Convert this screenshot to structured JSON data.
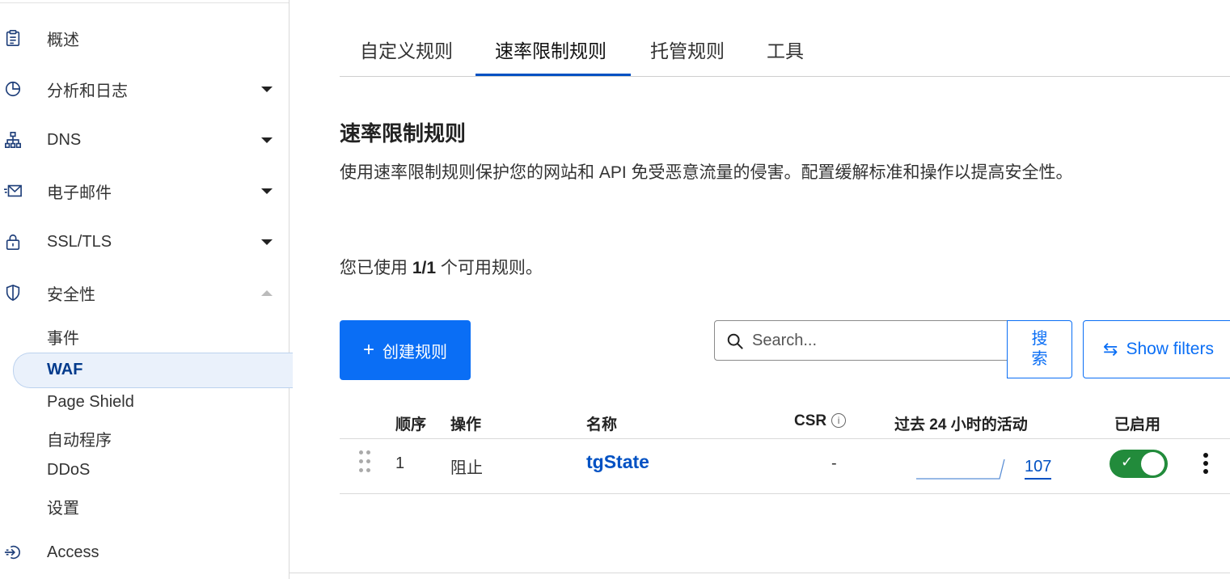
{
  "sidebar": {
    "items": [
      {
        "label": "概述",
        "icon": "clipboard-icon"
      },
      {
        "label": "分析和日志",
        "icon": "pie-chart-icon"
      },
      {
        "label": "DNS",
        "icon": "sitemap-icon"
      },
      {
        "label": "电子邮件",
        "icon": "envelope-icon"
      },
      {
        "label": "SSL/TLS",
        "icon": "lock-icon"
      },
      {
        "label": "安全性",
        "icon": "shield-icon"
      }
    ],
    "security_sub": [
      "事件",
      "WAF",
      "Page Shield",
      "自动程序",
      "DDoS",
      "设置"
    ],
    "access": {
      "label": "Access",
      "icon": "sign-in-icon"
    }
  },
  "tabs": [
    "自定义规则",
    "速率限制规则",
    "托管规则",
    "工具"
  ],
  "active_tab": "速率限制规则",
  "section": {
    "title": "速率限制规则",
    "description": "使用速率限制规则保护您的网站和 API 免受恶意流量的侵害。配置缓解标准和操作以提高安全性。",
    "usage_prefix": "您已使用",
    "usage_count": "1/1",
    "usage_suffix": "个可用规则。"
  },
  "toolbar": {
    "create_label": "创建规则",
    "search_placeholder": "Search...",
    "search_button": "搜索",
    "filters_label": "Show filters"
  },
  "table": {
    "headers": {
      "order": "顺序",
      "action": "操作",
      "name": "名称",
      "csr": "CSR",
      "activity": "过去 24 小时的活动",
      "enabled": "已启用"
    },
    "rows": [
      {
        "order": "1",
        "action": "阻止",
        "name": "tgState",
        "csr": "-",
        "activity": "107",
        "enabled": true
      }
    ]
  },
  "colors": {
    "accent": "#0a6ef5",
    "link": "#0051c3",
    "toggle_on": "#228b3b"
  }
}
